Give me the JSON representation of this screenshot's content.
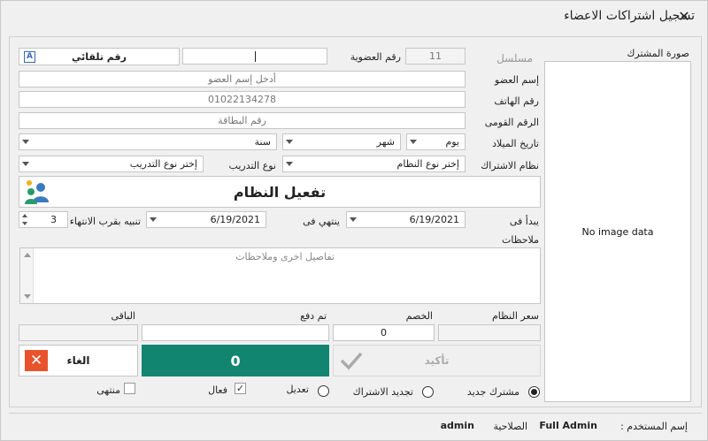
{
  "window": {
    "title": "تسجيل اشتراكات الاعضاء",
    "close_glyph": "✕"
  },
  "photo": {
    "label": "صورة المشترك",
    "empty_text": "No image data"
  },
  "form": {
    "serial_label": "مسلسل",
    "membership_no_label": "رقم العضوية",
    "membership_no_value": "11",
    "card_input_value": "",
    "auto_number_button": "رقم تلقائي",
    "auto_number_icon_letter": "A",
    "member_name_label": "إسم العضو",
    "member_name_placeholder": "أدخل إسم العضو",
    "phone_label": "رقم الهاتف",
    "phone_value": "01022134278",
    "national_id_label": "الرقم القومى",
    "national_id_placeholder": "رقم البطاقة",
    "birth_label": "تاريخ الميلاد",
    "birth_day": "يوم",
    "birth_month": "شهر",
    "birth_year": "سنة",
    "subscription_system_label": "نظام الاشتراك",
    "subscription_system_value": "إختر نوع النظام",
    "training_type_label": "نوع التدريب",
    "training_type_value": "إختر نوع التدريب"
  },
  "activate": {
    "label": "تفعيل النظام"
  },
  "dates": {
    "start_label": "يبدأ فى",
    "start_value": "6/19/2021",
    "end_label": "ينتهي فى",
    "end_value": "6/19/2021",
    "alert_label": "تنبيه بقرب الانتهاء",
    "alert_value": "3"
  },
  "notes": {
    "label": "ملاحظات",
    "placeholder": "تفاصيل اخرى وملاحظات"
  },
  "money": {
    "price_label": "سعر النظام",
    "price_value": "",
    "discount_label": "الخصم",
    "discount_value": "0",
    "paid_label": "تم دفع",
    "paid_value": "",
    "remaining_label": "الباقى",
    "remaining_value": ""
  },
  "actions": {
    "confirm_label": "تأكيد",
    "total_value": "0",
    "cancel_label": "الغاء",
    "confirm_color": "#aaaaaa",
    "total_bg": "#118570",
    "cancel_icon_bg": "#e8532c"
  },
  "options": {
    "new_subscriber": "مشترك جديد",
    "renew": "تجديد الاشتراك",
    "edit": "تعديل",
    "active": "فعال",
    "expired": "منتهى"
  },
  "footer": {
    "user_label": "إسم المستخدم :",
    "user_value": "Full Admin",
    "role_label": "الصلاحية",
    "role_value": "admin"
  }
}
